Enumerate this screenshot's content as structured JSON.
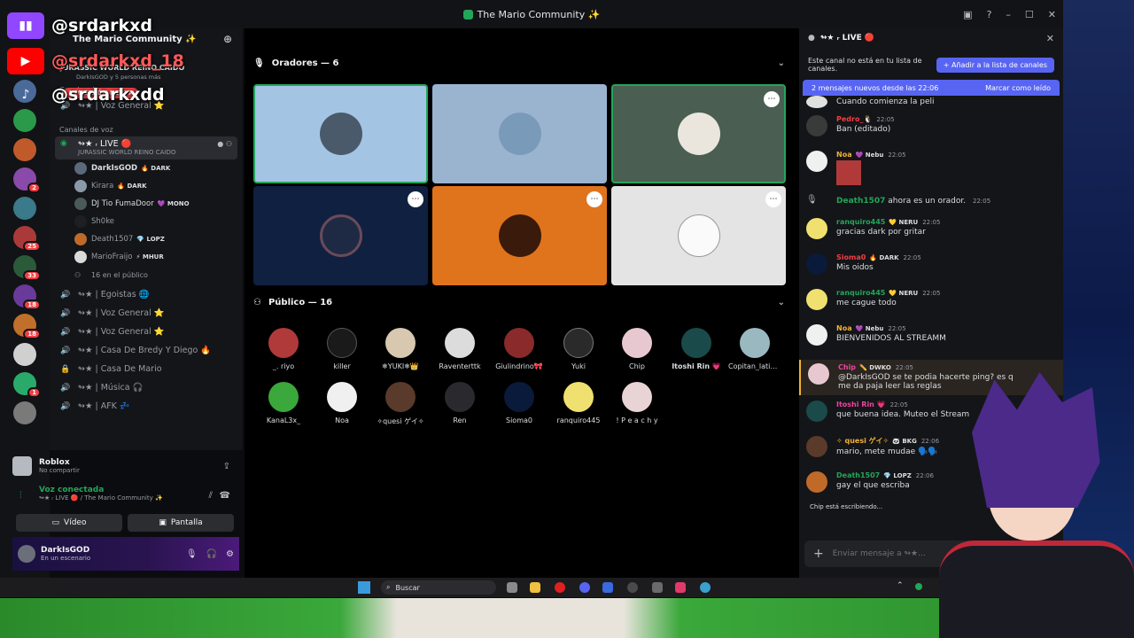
{
  "window": {
    "title": "The Mario Community ✨"
  },
  "overlay": {
    "twitch": "@srdarkxd",
    "youtube": "@srdarkxd_18",
    "tiktok": "@srdarkxdd"
  },
  "server": {
    "name": "The Mario Community ✨",
    "event": "JURASSIC WORLD REINO CAIDO",
    "event_sub": "DarkIsGOD y 5 personas más"
  },
  "sidebar": {
    "mention_pill": "1 MENCIÓN NUEVA",
    "cat_voice_top": "Canales de voz",
    "ch_voice_general_top": "↬★ | Voz General ⭐",
    "cat_voice": "Canales de voz",
    "live_channel": "↬★ ᵣ LIVE 🔴",
    "live_sub": "JURASSIC WORLD REINO CAIDO",
    "users": [
      {
        "name": "DarkIsGOD",
        "tag": "🔥 DARK"
      },
      {
        "name": "Kirara",
        "tag": "🔥 DARK"
      },
      {
        "name": "DJ Tio FumaDoor",
        "tag": "💜 MONO"
      },
      {
        "name": "Sh0ke",
        "tag": ""
      },
      {
        "name": "Dеаth1507",
        "tag": "💎 LOPZ"
      },
      {
        "name": "MarioFraijo",
        "tag": "⚡ MHUR"
      }
    ],
    "public_count": "16 en el público",
    "channels": [
      "↬★ | Egoistas 🌐",
      "↬★ | Voz General ⭐",
      "↬★ | Voz General ⭐",
      "↬★ | Casa De Bredy Y Diego 🔥",
      "↬★ | Casa De Mario",
      "↬★ | Música 🎧",
      "↬★ | AFK 💤"
    ]
  },
  "activity": {
    "game": "Roblox",
    "status": "No compartir"
  },
  "voice": {
    "connected": "Voz conectada",
    "location": "↬★ ᵣ LIVE 🔴 / The Mario Community ✨",
    "video_btn": "Vídeo",
    "screen_btn": "Pantalla"
  },
  "user": {
    "name": "DarkIsGOD",
    "status": "En un escenario"
  },
  "stage": {
    "speakers_header": "Oradores — 6",
    "audience_header": "Público — 16",
    "audience": [
      "_. riyo",
      "killer",
      "❄YUKI❄👑",
      "Raventerttk",
      "Giulindrino🎀",
      "Yuki",
      "Chip",
      "Itoshi Rin 💗",
      "Copitan_latin...",
      "KanaL3x_",
      "Noa",
      "✧quesi ゲイ✧",
      "Ren",
      "Sioma0",
      "ranquiro445",
      "! P e a c h y"
    ]
  },
  "chat": {
    "channel": "↬★ ᵣ LIVE 🔴",
    "notice": "Este canal no está en tu lista de canales.",
    "notice_btn": "+ Añadir a la lista de canales",
    "new_msgs": "2 mensajes nuevos desde las 22:06",
    "mark_read": "Marcar como leído",
    "messages": [
      {
        "author": "",
        "tag": "",
        "time": "",
        "text": "Cuando comienza la peli"
      },
      {
        "author": "Pedro_🐧",
        "tag": "",
        "time": "22:05",
        "text": "Ban (editado)"
      },
      {
        "author": "Noa",
        "tag": "💜 Nebu",
        "time": "22:05",
        "text": ""
      },
      {
        "author": "Dеаth1507",
        "tag": "",
        "time": "22:05",
        "text": "ahora es un orador."
      },
      {
        "author": "ranquiro445",
        "tag": "💛 NERU",
        "time": "22:05",
        "text": "gracias dark por gritar"
      },
      {
        "author": "Sioma0",
        "tag": "🔥 DARK",
        "time": "22:05",
        "text": "Mis oidos"
      },
      {
        "author": "ranquiro445",
        "tag": "💛 NERU",
        "time": "22:05",
        "text": "me cague todo"
      },
      {
        "author": "Noa",
        "tag": "💜 Nebu",
        "time": "22:05",
        "text": "BIENVENIDOS AL STREAMM"
      },
      {
        "author": "Chip",
        "tag": "✏️ DWKO",
        "time": "22:05",
        "text": "@DarkIsGOD se te podia hacerte ping? es q me da paja leer las reglas"
      },
      {
        "author": "Itoshi Rin 💗",
        "tag": "",
        "time": "22:05",
        "text": "que buena idea. Muteo el Stream"
      },
      {
        "author": "✧ quesi ゲイ✧",
        "tag": "🐼 BKG",
        "time": "22:06",
        "text": "mario, mete mudae 🗣️🗣️"
      },
      {
        "author": "Dеаth1507",
        "tag": "💎 LOPZ",
        "time": "22:06",
        "text": "gay el que escriba"
      }
    ],
    "typing": "Chip está escribiendo...",
    "input_placeholder": "Enviar mensaje a ↬★..."
  },
  "taskbar": {
    "search": "Buscar"
  },
  "colors": {
    "accent": "#5865f2",
    "online": "#23a55a",
    "danger": "#f23f43"
  }
}
